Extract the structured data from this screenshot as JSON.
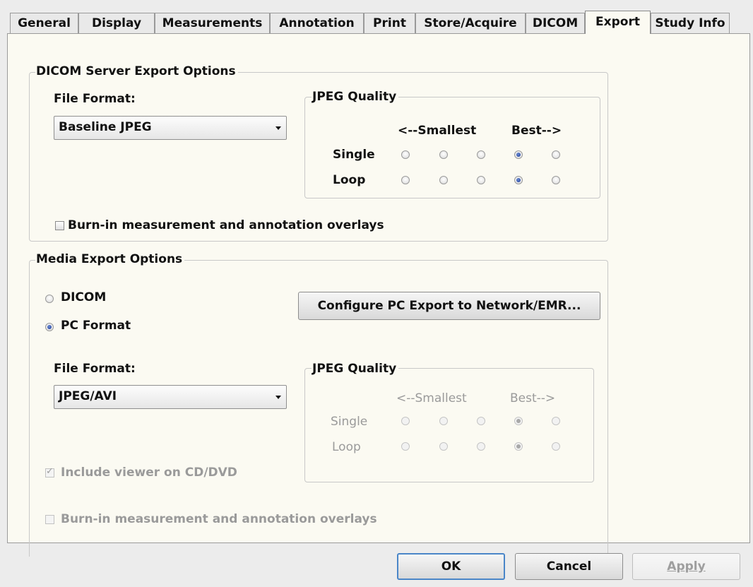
{
  "tabs": [
    "General",
    "Display",
    "Measurements",
    "Annotation",
    "Print",
    "Store/Acquire",
    "DICOM",
    "Export",
    "Study Info"
  ],
  "active_tab": "Export",
  "dicom_server": {
    "title": "DICOM Server Export Options",
    "file_format_label": "File Format:",
    "file_format_value": "Baseline JPEG",
    "jpeg_quality": {
      "title": "JPEG Quality",
      "smallest_label": "<--Smallest",
      "best_label": "Best-->",
      "rows": [
        {
          "label": "Single",
          "selected_index": 3
        },
        {
          "label": "Loop",
          "selected_index": 3
        }
      ]
    },
    "burn_in_label": "Burn-in measurement and annotation overlays",
    "burn_in_checked": false
  },
  "media": {
    "title": "Media Export Options",
    "dicom_option": "DICOM",
    "pc_format_option": "PC Format",
    "selected_option": "PC Format",
    "configure_button": "Configure PC Export to Network/EMR...",
    "file_format_label": "File Format:",
    "file_format_value": "JPEG/AVI",
    "jpeg_quality": {
      "title": "JPEG Quality",
      "smallest_label": "<--Smallest",
      "best_label": "Best-->",
      "rows": [
        {
          "label": "Single",
          "selected_index": 3
        },
        {
          "label": "Loop",
          "selected_index": 3
        }
      ]
    },
    "include_viewer_label": "Include viewer on CD/DVD",
    "include_viewer_checked": true,
    "burn_in_label": "Burn-in measurement and annotation overlays",
    "burn_in_checked": false
  },
  "buttons": {
    "ok": "OK",
    "cancel": "Cancel",
    "apply": "Apply"
  }
}
